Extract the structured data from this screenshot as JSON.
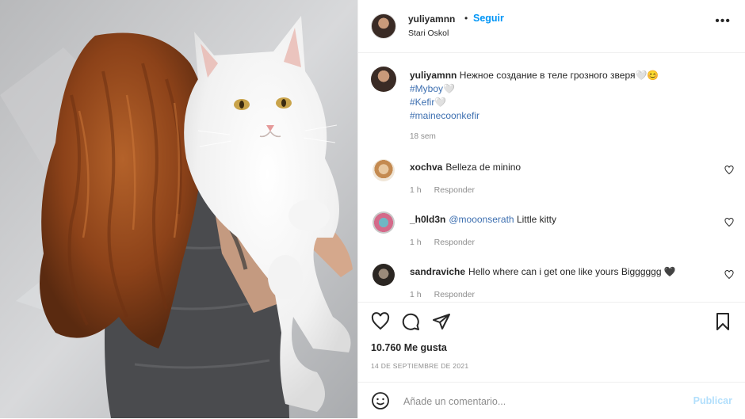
{
  "post": {
    "username": "yuliyamnn",
    "separator": "•",
    "follow_label": "Seguir",
    "location": "Stari Oskol",
    "more_label": "•••"
  },
  "caption": {
    "username": "yuliyamnn",
    "text": "Нежное создание в теле грозного зверя🤍😊",
    "tags": [
      "#Myboy🤍",
      "#Kefir🤍",
      "#mainecoonkefir"
    ],
    "time": "18 sem"
  },
  "comments": [
    {
      "username": "xochva",
      "mention": "",
      "text": "Belleza de minino",
      "time": "1 h",
      "reply_label": "Responder"
    },
    {
      "username": "_h0ld3n",
      "mention": "@mooonserath",
      "text": "Little kitty",
      "time": "1 h",
      "reply_label": "Responder"
    },
    {
      "username": "sandraviche",
      "mention": "",
      "text": "Hello where can i get one like yours Bigggggg 🖤",
      "time": "1 h",
      "reply_label": "Responder"
    }
  ],
  "actions": {
    "likes": "10.760 Me gusta",
    "date": "14 DE SEPTIEMBRE DE 2021"
  },
  "add_comment": {
    "placeholder": "Añade un comentario...",
    "publish_label": "Publicar"
  },
  "icons": [
    "heart-icon",
    "comment-icon",
    "share-icon",
    "bookmark-icon",
    "emoji-icon",
    "more-icon"
  ],
  "colors": {
    "accent": "#0095f6",
    "mention": "#3d6fb0",
    "muted": "#8e8e8e",
    "text": "#262626"
  }
}
